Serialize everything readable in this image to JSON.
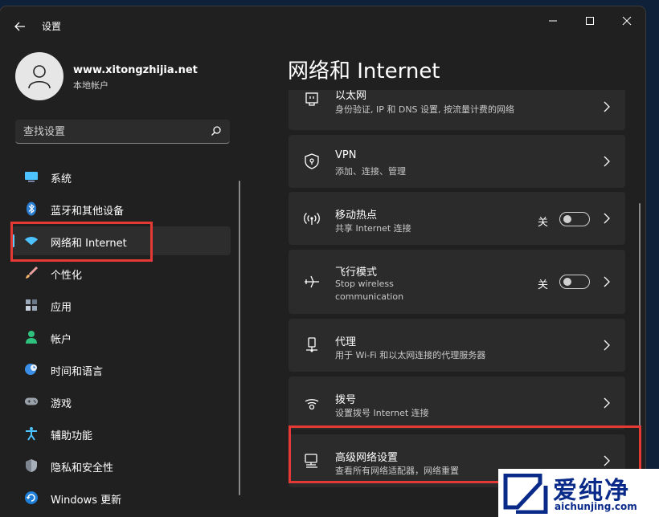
{
  "window": {
    "title": "设置"
  },
  "user": {
    "name": "www.xitongzhijia.net",
    "account_type": "本地帐户"
  },
  "search": {
    "placeholder": "查找设置"
  },
  "sidebar": {
    "items": [
      {
        "label": "系统",
        "icon": "system-icon"
      },
      {
        "label": "蓝牙和其他设备",
        "icon": "bluetooth-icon"
      },
      {
        "label": "网络和 Internet",
        "icon": "wifi-icon",
        "selected": true
      },
      {
        "label": "个性化",
        "icon": "brush-icon"
      },
      {
        "label": "应用",
        "icon": "apps-icon"
      },
      {
        "label": "帐户",
        "icon": "account-icon"
      },
      {
        "label": "时间和语言",
        "icon": "globe-clock-icon"
      },
      {
        "label": "游戏",
        "icon": "gamepad-icon"
      },
      {
        "label": "辅助功能",
        "icon": "accessibility-icon"
      },
      {
        "label": "隐私和安全性",
        "icon": "shield-icon"
      },
      {
        "label": "Windows 更新",
        "icon": "update-icon"
      }
    ]
  },
  "main": {
    "title": "网络和 Internet",
    "cards": [
      {
        "title": "以太网",
        "subtitle": "身份验证, IP 和 DNS 设置, 按流量计费的网络",
        "icon": "ethernet-icon"
      },
      {
        "title": "VPN",
        "subtitle": "添加、连接、管理",
        "icon": "vpn-shield-icon"
      },
      {
        "title": "移动热点",
        "subtitle": "共享 Internet 连接",
        "icon": "hotspot-icon",
        "toggle_state": "关",
        "toggle_on": false
      },
      {
        "title": "飞行模式",
        "subtitle_line1": "Stop wireless",
        "subtitle_line2": "communication",
        "icon": "airplane-icon",
        "toggle_state": "关",
        "toggle_on": false
      },
      {
        "title": "代理",
        "subtitle": "用于 Wi-Fi 和以太网连接的代理服务器",
        "icon": "proxy-icon"
      },
      {
        "title": "拨号",
        "subtitle": "设置拨号 Internet 连接",
        "icon": "dialup-icon"
      },
      {
        "title": "高级网络设置",
        "subtitle": "查看所有网络适配器，网络重置",
        "icon": "advanced-network-icon"
      }
    ]
  },
  "colors": {
    "accent": "#60cdff",
    "highlight": "#e53935",
    "window_bg": "#202020",
    "card_bg": "#2b2b2b"
  },
  "watermark": {
    "brand": "爱纯净",
    "url": "aichunjing.com"
  }
}
